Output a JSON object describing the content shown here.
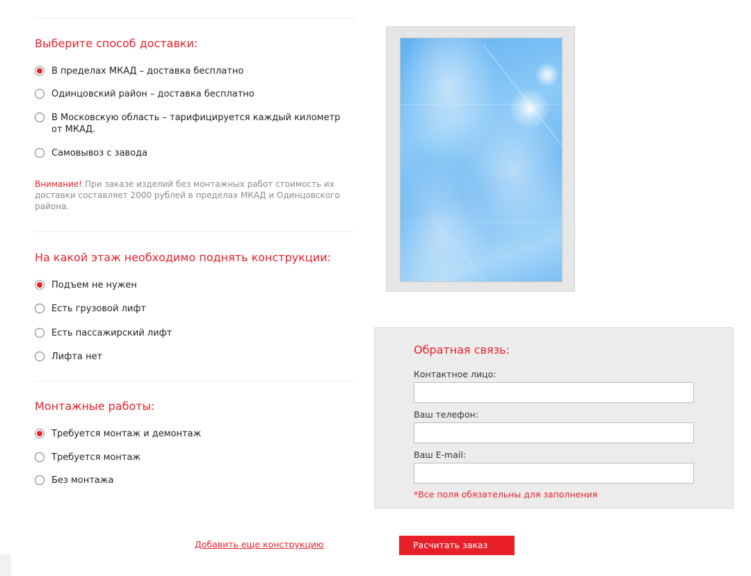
{
  "delivery": {
    "title": "Выберите способ доставки:",
    "options": [
      {
        "label": "В пределах МКАД – доставка бесплатно",
        "checked": true
      },
      {
        "label": "Одинцовский район – доставка бесплатно",
        "checked": false
      },
      {
        "label": "В Московскую область – тарифицируется каждый километр от МКАД.",
        "checked": false
      },
      {
        "label": "Самовывоз с завода",
        "checked": false
      }
    ],
    "notice_prefix": "Внимание!",
    "notice_text": " При заказе изделий без монтажных работ стоимость их доставки составляет 2000 рублей в пределах МКАД и Одинцовского района."
  },
  "floor": {
    "title": "На какой этаж необходимо поднять конструкции:",
    "options": [
      {
        "label": "Подъем не нужен",
        "checked": true
      },
      {
        "label": "Есть грузовой лифт",
        "checked": false
      },
      {
        "label": "Есть пассажирский лифт",
        "checked": false
      },
      {
        "label": "Лифта нет",
        "checked": false
      }
    ]
  },
  "installation": {
    "title": "Монтажные работы:",
    "options": [
      {
        "label": "Требуется монтаж и демонтаж",
        "checked": true
      },
      {
        "label": "Требуется монтаж",
        "checked": false
      },
      {
        "label": "Без монтажа",
        "checked": false
      }
    ]
  },
  "feedback": {
    "title": "Обратная связь:",
    "contact_label": "Контактное лицо:",
    "contact_value": "",
    "phone_label": "Ваш телефон:",
    "phone_value": "",
    "email_label": "Ваш E-mail:",
    "email_value": "",
    "required_note": "*Все поля обязательны для заполнения"
  },
  "actions": {
    "add_link": "Добавить еще конструкцию",
    "calculate": "Расчитать заказ"
  },
  "colors": {
    "accent": "#e8202a",
    "panel": "#ececec"
  }
}
